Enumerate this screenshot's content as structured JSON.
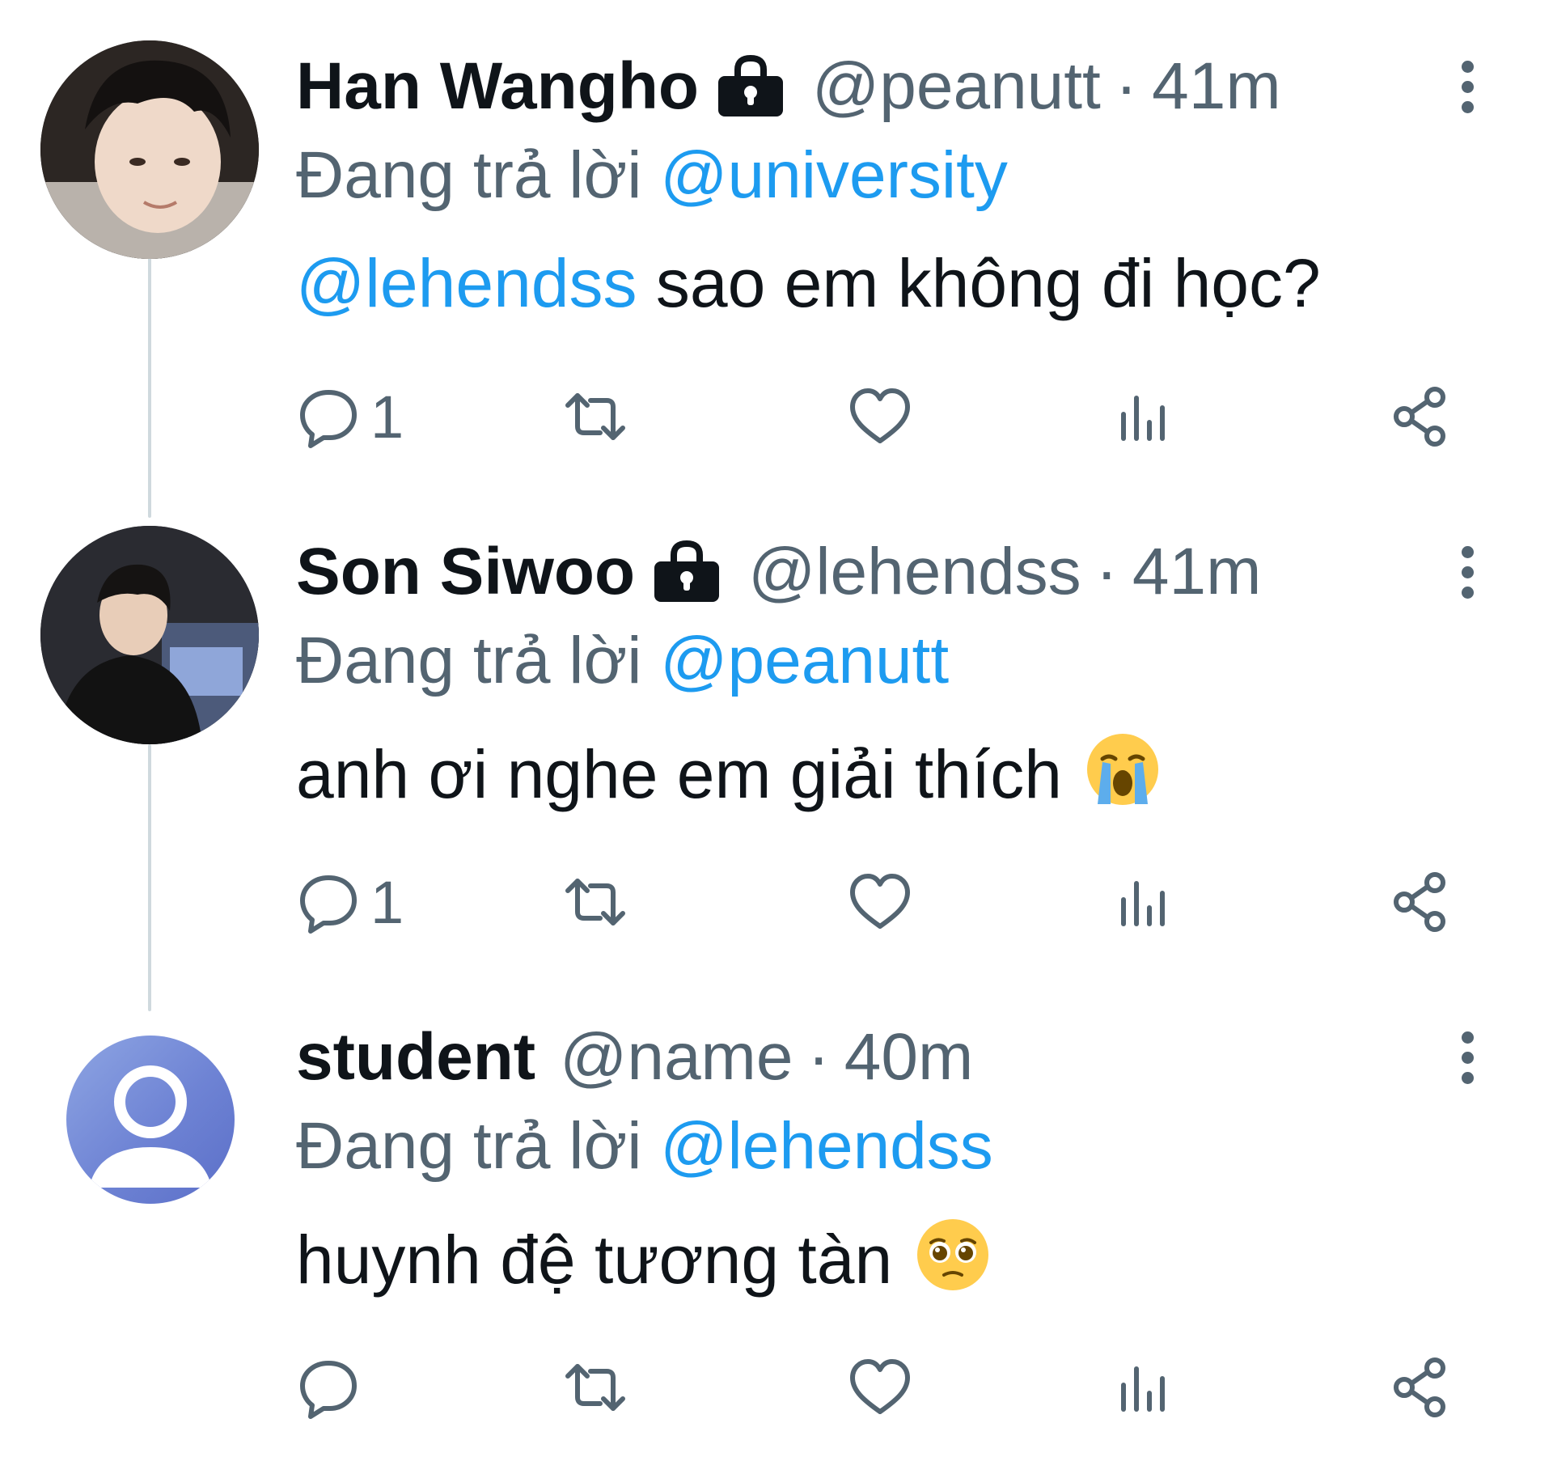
{
  "thread": {
    "tweets": [
      {
        "name": "Han Wangho",
        "protected": true,
        "handle": "@peanutt",
        "separator": "·",
        "time": "41m",
        "reply_prefix": "Đang trả lời",
        "reply_to": "@university",
        "body_mention": "@lehendss",
        "body_text": " sao em không đi học?",
        "emoji": "",
        "reply_count": "1",
        "avatar": "user-photo"
      },
      {
        "name": "Son Siwoo",
        "protected": true,
        "handle": "@lehendss",
        "separator": "·",
        "time": "41m",
        "reply_prefix": "Đang trả lời",
        "reply_to": "@peanutt",
        "body_mention": "",
        "body_text": "anh ơi nghe em giải thích",
        "emoji": "loudly-crying-face",
        "reply_count": "1",
        "avatar": "user-photo"
      },
      {
        "name": "student",
        "protected": false,
        "handle": "@name",
        "separator": "·",
        "time": "40m",
        "reply_prefix": "Đang trả lời",
        "reply_to": "@lehendss",
        "body_mention": "",
        "body_text": "huynh đệ tương tàn",
        "emoji": "pleading-face",
        "reply_count": "",
        "avatar": "default-avatar"
      }
    ]
  },
  "icons": {
    "lock": "lock-icon",
    "more": "more-vertical-icon",
    "reply": "reply-icon",
    "retweet": "retweet-icon",
    "like": "heart-icon",
    "views": "views-icon",
    "share": "share-icon"
  },
  "colors": {
    "text": "#0f1419",
    "secondary": "#536471",
    "link": "#1d9bf0",
    "connector": "#cfd9de",
    "default_avatar": "#6e83d4"
  }
}
